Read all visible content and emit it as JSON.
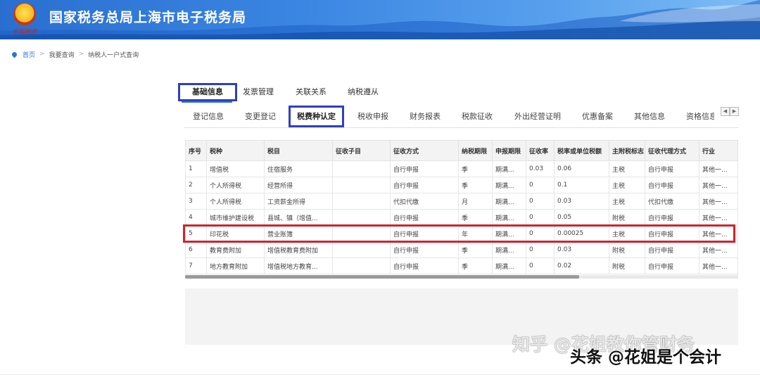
{
  "header": {
    "title": "国家税务总局上海市电子税务局",
    "emblem_text": "中国税务",
    "colors": {
      "banner": "#3b86e2",
      "title": "#ffffff"
    }
  },
  "breadcrumb": {
    "home": "首页",
    "items": [
      "我要查询",
      "纳税人一户式查询"
    ],
    "separator": ">"
  },
  "main_tabs": [
    {
      "label": "基础信息",
      "active": true
    },
    {
      "label": "发票管理",
      "active": false
    },
    {
      "label": "关联关系",
      "active": false
    },
    {
      "label": "纳税遵从",
      "active": false
    }
  ],
  "sub_tabs": [
    {
      "label": "登记信息",
      "active": false
    },
    {
      "label": "变更登记",
      "active": false
    },
    {
      "label": "税费种认定",
      "active": true
    },
    {
      "label": "税收申报",
      "active": false
    },
    {
      "label": "财务报表",
      "active": false
    },
    {
      "label": "税款征收",
      "active": false
    },
    {
      "label": "外出经营证明",
      "active": false
    },
    {
      "label": "优惠备案",
      "active": false
    },
    {
      "label": "其他信息",
      "active": false
    },
    {
      "label": "资格信息",
      "active": false
    }
  ],
  "sub_tab_arrows": {
    "prev": "◀",
    "next": "▶"
  },
  "table": {
    "columns": [
      "序号",
      "税种",
      "税目",
      "征收子目",
      "征收方式",
      "纳税期限",
      "申报期限",
      "征收率",
      "税率或单位税额",
      "主附税标志",
      "征收代理方式",
      "行业"
    ],
    "rows": [
      [
        "1",
        "增值税",
        "住宿服务",
        "",
        "自行申报",
        "季",
        "期满...",
        "0.03",
        "0.06",
        "主税",
        "自行申报",
        "其他一..."
      ],
      [
        "2",
        "个人所得税",
        "经营所得",
        "",
        "自行申报",
        "季",
        "期满...",
        "0",
        "0.1",
        "主税",
        "自行申报",
        "其他一..."
      ],
      [
        "3",
        "个人所得税",
        "工资薪金所得",
        "",
        "代扣代缴",
        "月",
        "期满...",
        "0",
        "0.03",
        "主税",
        "代扣代缴",
        "其他一..."
      ],
      [
        "4",
        "城市维护建设税",
        "县城、镇（增值...",
        "",
        "自行申报",
        "季",
        "期满...",
        "0",
        "0.05",
        "附税",
        "自行申报",
        "其他一..."
      ],
      [
        "5",
        "印花税",
        "营业账簿",
        "",
        "自行申报",
        "年",
        "期满...",
        "0",
        "0.00025",
        "主税",
        "自行申报",
        "其他一..."
      ],
      [
        "6",
        "教育费附加",
        "增值税教育费附加",
        "",
        "自行申报",
        "季",
        "期满...",
        "0",
        "0.03",
        "附税",
        "自行申报",
        "其他一..."
      ],
      [
        "7",
        "地方教育附加",
        "增值税地方教育...",
        "",
        "自行申报",
        "季",
        "期满...",
        "0",
        "0.02",
        "附税",
        "自行申报",
        "其他一..."
      ]
    ],
    "highlight_row_index": 4,
    "highlight_color": "#d2232a"
  },
  "watermarks": {
    "zhihu": "知乎 @花姐教你管财务",
    "toutiao": "头条 @花姐是个会计"
  }
}
